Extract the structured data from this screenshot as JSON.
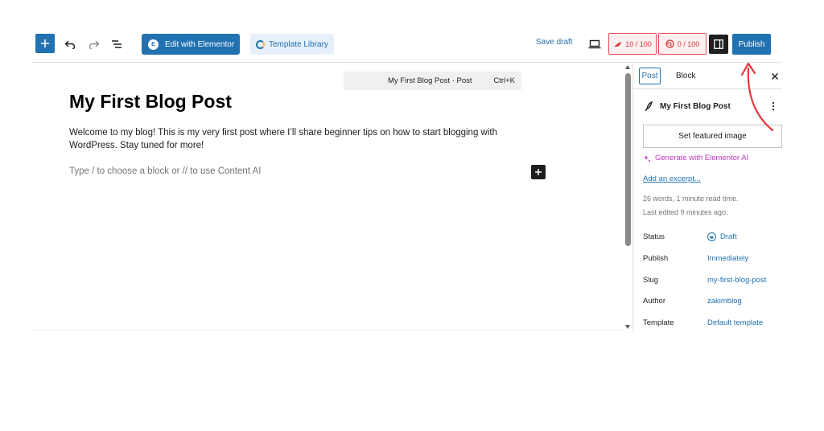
{
  "toolbar": {
    "edit_elementor_label": "Edit with Elementor",
    "template_library_label": "Template Library",
    "save_draft_label": "Save draft",
    "score_readability": "10 / 100",
    "score_seo": "0 / 100",
    "publish_label": "Publish"
  },
  "command_bar": {
    "title": "My First Blog Post · Post",
    "shortcut": "Ctrl+K"
  },
  "editor": {
    "title": "My First Blog Post",
    "body": "Welcome to my blog! This is my very first post where I’ll share beginner tips on how to start blogging with WordPress. Stay tuned for more!",
    "placeholder": "Type / to choose a block or // to use Content AI"
  },
  "sidebar": {
    "tab_post": "Post",
    "tab_block": "Block",
    "post_title": "My First Blog Post",
    "featured_image_label": "Set featured image",
    "generate_ai_label": "Generate with Elementor AI",
    "excerpt_link": "Add an excerpt...",
    "word_count": "26 words, 1 minute read time.",
    "last_edited": "Last edited 9 minutes ago.",
    "rows": [
      {
        "label": "Status",
        "value": "Draft"
      },
      {
        "label": "Publish",
        "value": "Immediately"
      },
      {
        "label": "Slug",
        "value": "my-first-blog-post"
      },
      {
        "label": "Author",
        "value": "zakimblog"
      },
      {
        "label": "Template",
        "value": "Default template"
      }
    ]
  },
  "colors": {
    "accent": "#2271b1",
    "score_red": "#d63638",
    "ai_purple": "#c036c2",
    "annotation_arrow": "#e8343b"
  }
}
